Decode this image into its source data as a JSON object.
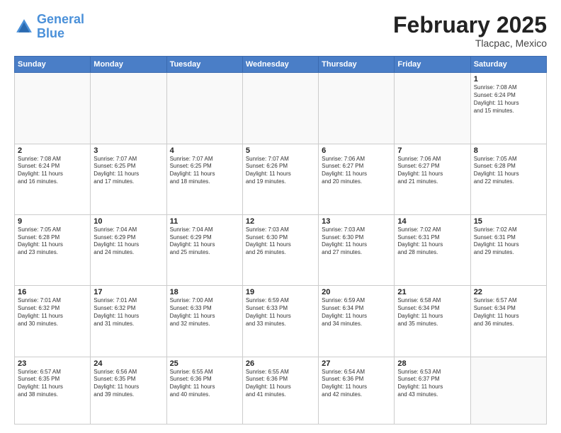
{
  "header": {
    "logo_line1": "General",
    "logo_line2": "Blue",
    "month_year": "February 2025",
    "location": "Tlacpac, Mexico"
  },
  "weekdays": [
    "Sunday",
    "Monday",
    "Tuesday",
    "Wednesday",
    "Thursday",
    "Friday",
    "Saturday"
  ],
  "weeks": [
    [
      {
        "day": "",
        "info": ""
      },
      {
        "day": "",
        "info": ""
      },
      {
        "day": "",
        "info": ""
      },
      {
        "day": "",
        "info": ""
      },
      {
        "day": "",
        "info": ""
      },
      {
        "day": "",
        "info": ""
      },
      {
        "day": "1",
        "info": "Sunrise: 7:08 AM\nSunset: 6:24 PM\nDaylight: 11 hours\nand 15 minutes."
      }
    ],
    [
      {
        "day": "2",
        "info": "Sunrise: 7:08 AM\nSunset: 6:24 PM\nDaylight: 11 hours\nand 16 minutes."
      },
      {
        "day": "3",
        "info": "Sunrise: 7:07 AM\nSunset: 6:25 PM\nDaylight: 11 hours\nand 17 minutes."
      },
      {
        "day": "4",
        "info": "Sunrise: 7:07 AM\nSunset: 6:25 PM\nDaylight: 11 hours\nand 18 minutes."
      },
      {
        "day": "5",
        "info": "Sunrise: 7:07 AM\nSunset: 6:26 PM\nDaylight: 11 hours\nand 19 minutes."
      },
      {
        "day": "6",
        "info": "Sunrise: 7:06 AM\nSunset: 6:27 PM\nDaylight: 11 hours\nand 20 minutes."
      },
      {
        "day": "7",
        "info": "Sunrise: 7:06 AM\nSunset: 6:27 PM\nDaylight: 11 hours\nand 21 minutes."
      },
      {
        "day": "8",
        "info": "Sunrise: 7:05 AM\nSunset: 6:28 PM\nDaylight: 11 hours\nand 22 minutes."
      }
    ],
    [
      {
        "day": "9",
        "info": "Sunrise: 7:05 AM\nSunset: 6:28 PM\nDaylight: 11 hours\nand 23 minutes."
      },
      {
        "day": "10",
        "info": "Sunrise: 7:04 AM\nSunset: 6:29 PM\nDaylight: 11 hours\nand 24 minutes."
      },
      {
        "day": "11",
        "info": "Sunrise: 7:04 AM\nSunset: 6:29 PM\nDaylight: 11 hours\nand 25 minutes."
      },
      {
        "day": "12",
        "info": "Sunrise: 7:03 AM\nSunset: 6:30 PM\nDaylight: 11 hours\nand 26 minutes."
      },
      {
        "day": "13",
        "info": "Sunrise: 7:03 AM\nSunset: 6:30 PM\nDaylight: 11 hours\nand 27 minutes."
      },
      {
        "day": "14",
        "info": "Sunrise: 7:02 AM\nSunset: 6:31 PM\nDaylight: 11 hours\nand 28 minutes."
      },
      {
        "day": "15",
        "info": "Sunrise: 7:02 AM\nSunset: 6:31 PM\nDaylight: 11 hours\nand 29 minutes."
      }
    ],
    [
      {
        "day": "16",
        "info": "Sunrise: 7:01 AM\nSunset: 6:32 PM\nDaylight: 11 hours\nand 30 minutes."
      },
      {
        "day": "17",
        "info": "Sunrise: 7:01 AM\nSunset: 6:32 PM\nDaylight: 11 hours\nand 31 minutes."
      },
      {
        "day": "18",
        "info": "Sunrise: 7:00 AM\nSunset: 6:33 PM\nDaylight: 11 hours\nand 32 minutes."
      },
      {
        "day": "19",
        "info": "Sunrise: 6:59 AM\nSunset: 6:33 PM\nDaylight: 11 hours\nand 33 minutes."
      },
      {
        "day": "20",
        "info": "Sunrise: 6:59 AM\nSunset: 6:34 PM\nDaylight: 11 hours\nand 34 minutes."
      },
      {
        "day": "21",
        "info": "Sunrise: 6:58 AM\nSunset: 6:34 PM\nDaylight: 11 hours\nand 35 minutes."
      },
      {
        "day": "22",
        "info": "Sunrise: 6:57 AM\nSunset: 6:34 PM\nDaylight: 11 hours\nand 36 minutes."
      }
    ],
    [
      {
        "day": "23",
        "info": "Sunrise: 6:57 AM\nSunset: 6:35 PM\nDaylight: 11 hours\nand 38 minutes."
      },
      {
        "day": "24",
        "info": "Sunrise: 6:56 AM\nSunset: 6:35 PM\nDaylight: 11 hours\nand 39 minutes."
      },
      {
        "day": "25",
        "info": "Sunrise: 6:55 AM\nSunset: 6:36 PM\nDaylight: 11 hours\nand 40 minutes."
      },
      {
        "day": "26",
        "info": "Sunrise: 6:55 AM\nSunset: 6:36 PM\nDaylight: 11 hours\nand 41 minutes."
      },
      {
        "day": "27",
        "info": "Sunrise: 6:54 AM\nSunset: 6:36 PM\nDaylight: 11 hours\nand 42 minutes."
      },
      {
        "day": "28",
        "info": "Sunrise: 6:53 AM\nSunset: 6:37 PM\nDaylight: 11 hours\nand 43 minutes."
      },
      {
        "day": "",
        "info": ""
      }
    ]
  ]
}
